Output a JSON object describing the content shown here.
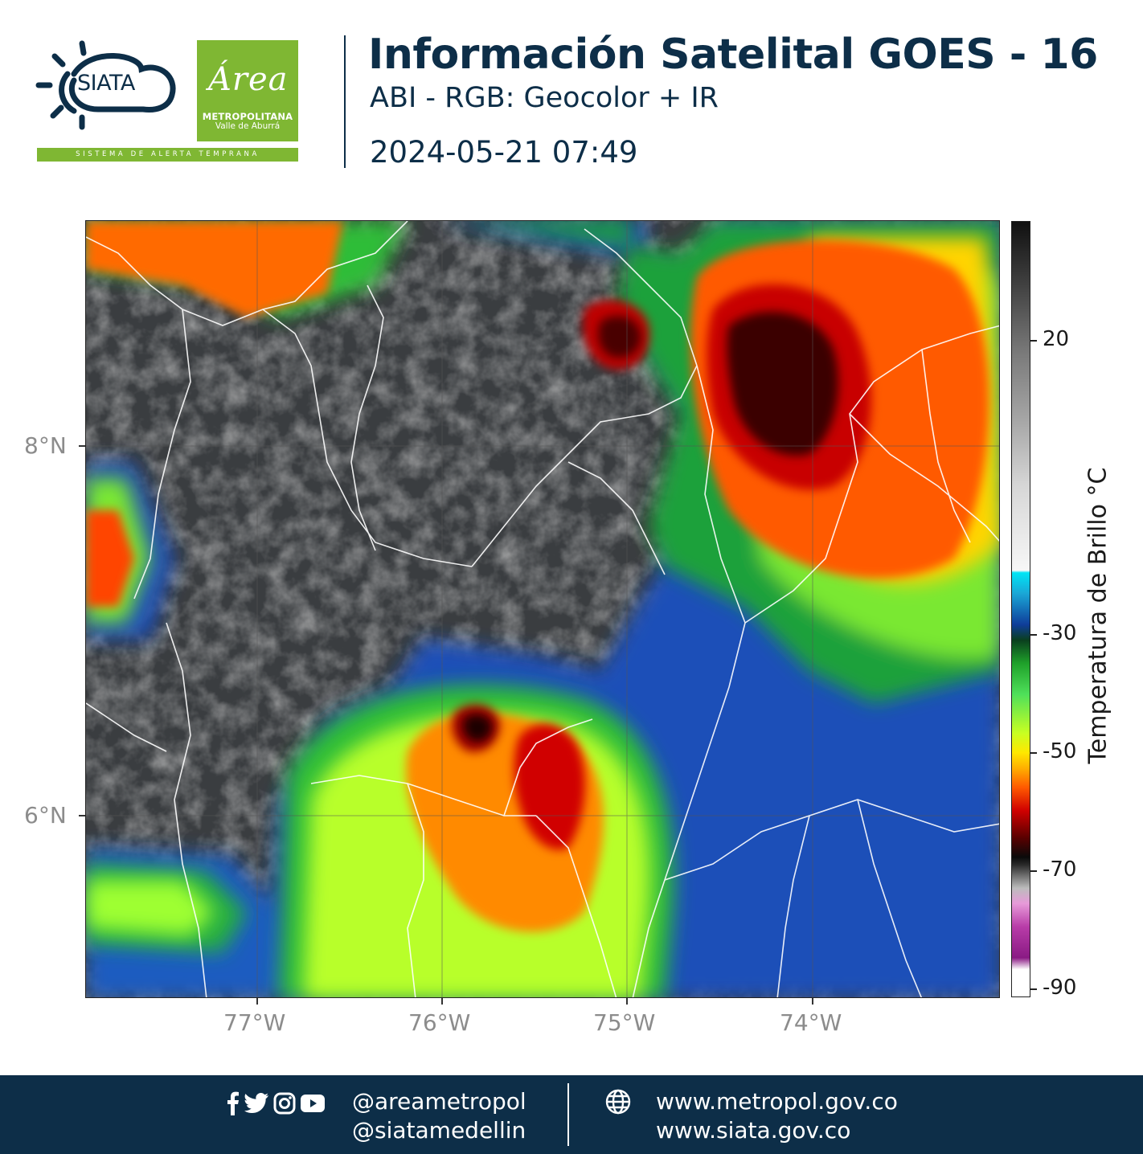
{
  "header": {
    "siata_logo_text": "SIATA",
    "siata_tagline": "SISTEMA DE ALERTA TEMPRANA",
    "area_logo": {
      "script": "Área",
      "line1": "METROPOLITANA",
      "line2": "Valle de Aburrá"
    },
    "title": "Información Satelital GOES - 16",
    "subtitle": "ABI - RGB: Geocolor + IR",
    "datetime": "2024-05-21 07:49"
  },
  "map": {
    "lat_labels": [
      "8°N",
      "6°N"
    ],
    "lon_labels": [
      "77°W",
      "76°W",
      "75°W",
      "74°W"
    ]
  },
  "colorbar": {
    "title": "Temperatura de Brillo °C",
    "tick_labels": [
      "20",
      "-30",
      "-50",
      "-70",
      "-90"
    ]
  },
  "footer": {
    "handles": [
      "@areametropol",
      "@siatamedellin"
    ],
    "urls": [
      "www.metropol.gov.co",
      "www.siata.gov.co"
    ],
    "icons": [
      "facebook-icon",
      "twitter-icon",
      "instagram-icon",
      "youtube-icon",
      "globe-icon"
    ]
  },
  "colors": {
    "navy": "#0d2e48",
    "green": "#7fb733"
  }
}
